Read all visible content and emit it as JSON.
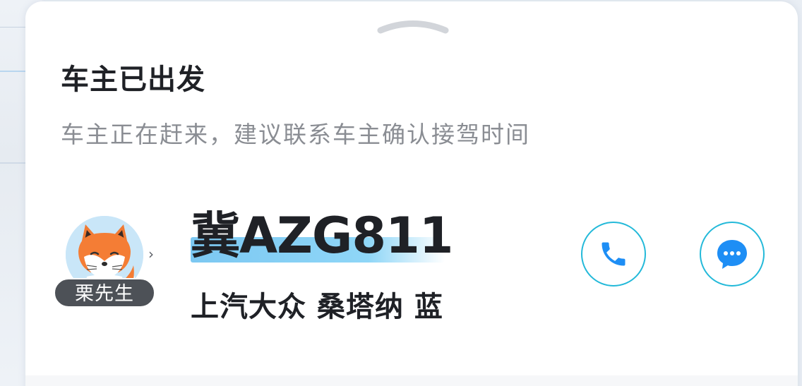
{
  "status": {
    "title": "车主已出发",
    "subtitle": "车主正在赶来，建议联系车主确认接驾时间"
  },
  "driver": {
    "name": "栗先生",
    "avatar_icon": "fox-avatar-icon"
  },
  "vehicle": {
    "plate": "冀AZG811",
    "description": "上汽大众 桑塔纳 蓝"
  },
  "actions": {
    "call_icon": "phone-icon",
    "message_icon": "chat-bubble-icon"
  },
  "colors": {
    "accent": "#23b9d9",
    "icon_blue": "#1e8ef5",
    "plate_highlight": "#7cc8f2",
    "badge_bg": "#4d5157"
  }
}
